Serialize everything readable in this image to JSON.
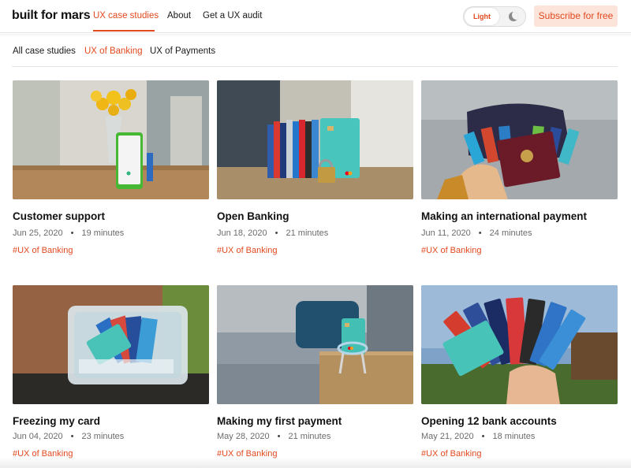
{
  "brand": {
    "logo": "built for mars",
    "accent": "#e2491f"
  },
  "nav": {
    "links": [
      {
        "label": "UX case studies",
        "active": true
      },
      {
        "label": "About",
        "active": false
      },
      {
        "label": "Get a UX audit",
        "active": false
      }
    ],
    "theme_toggle": {
      "light_label": "Light",
      "dark_icon": "moon-icon",
      "selected": "Light"
    },
    "subscribe_label": "Subscribe for free"
  },
  "tabs": [
    {
      "label": "All case studies",
      "active": false
    },
    {
      "label": "UX of Banking",
      "active": true
    },
    {
      "label": "UX of Payments",
      "active": false
    }
  ],
  "cards": [
    {
      "title": "Customer support",
      "date": "Jun 25, 2020",
      "separator": "•",
      "read_time": "19 minutes",
      "tag": "#UX of Banking"
    },
    {
      "title": "Open Banking",
      "date": "Jun 18, 2020",
      "separator": "•",
      "read_time": "21 minutes",
      "tag": "#UX of Banking"
    },
    {
      "title": "Making an international payment",
      "date": "Jun 11, 2020",
      "separator": "•",
      "read_time": "24 minutes",
      "tag": "#UX of Banking"
    },
    {
      "title": "Freezing my card",
      "date": "Jun 04, 2020",
      "separator": "•",
      "read_time": "23 minutes",
      "tag": "#UX of Banking"
    },
    {
      "title": "Making my first payment",
      "date": "May 28, 2020",
      "separator": "•",
      "read_time": "21 minutes",
      "tag": "#UX of Banking"
    },
    {
      "title": "Opening 12 bank accounts",
      "date": "May 21, 2020",
      "separator": "•",
      "read_time": "18 minutes",
      "tag": "#UX of Banking"
    }
  ]
}
